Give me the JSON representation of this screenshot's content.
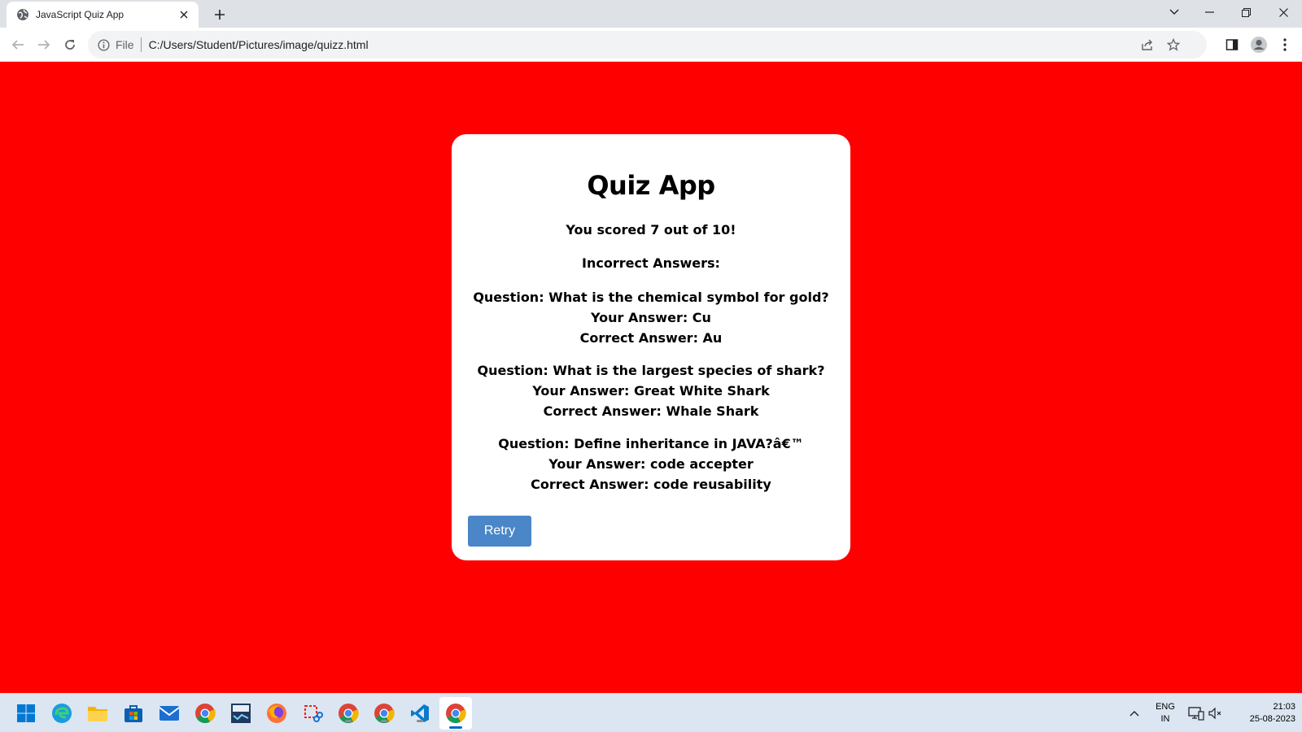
{
  "browser": {
    "tab_title": "JavaScript Quiz App",
    "omnibox_scheme_label": "File",
    "url": "C:/Users/Student/Pictures/image/quizz.html"
  },
  "quiz": {
    "title": "Quiz App",
    "score_text": "You scored 7 out of 10!",
    "incorrect_heading": "Incorrect Answers:",
    "incorrect": [
      {
        "question": "Question: What is the chemical symbol for gold?",
        "your_answer": "Your Answer: Cu",
        "correct_answer": "Correct Answer: Au"
      },
      {
        "question": "Question: What is the largest species of shark?",
        "your_answer": "Your Answer: Great White Shark",
        "correct_answer": "Correct Answer: Whale Shark"
      },
      {
        "question": "Question: Define inheritance in JAVA?â€™",
        "your_answer": "Your Answer: code accepter",
        "correct_answer": "Correct Answer: code reusability"
      }
    ],
    "retry_label": "Retry"
  },
  "taskbar": {
    "language_line1": "ENG",
    "language_line2": "IN",
    "time": "21:03",
    "date": "25-08-2023",
    "icons": [
      "windows-start-icon",
      "edge-icon",
      "file-explorer-icon",
      "microsoft-store-icon",
      "mail-icon",
      "chrome-icon",
      "dev-tool-icon",
      "firefox-icon",
      "snipping-tool-icon",
      "chrome-icon",
      "chrome-icon",
      "vscode-icon",
      "chrome-active-icon"
    ]
  },
  "colors": {
    "page_background": "#ff0000",
    "card_background": "#ffffff",
    "retry_button": "#4a86c8",
    "taskbar": "#dbe6f2"
  }
}
